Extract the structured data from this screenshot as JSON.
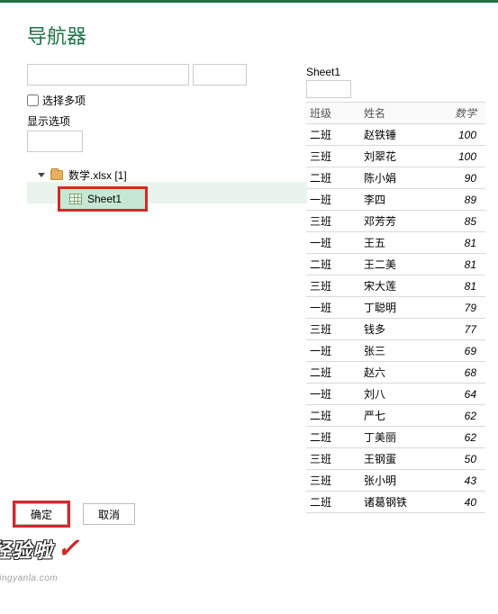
{
  "title": "导航器",
  "search": {
    "value": "",
    "placeholder": ""
  },
  "multi_select_label": "选择多项",
  "display_options_label": "显示选项",
  "tree": {
    "root_label": "数学.xlsx [1]",
    "sheet_label": "Sheet1"
  },
  "preview_title": "Sheet1",
  "chart_data": {
    "type": "table",
    "columns": [
      "班级",
      "姓名",
      "数学"
    ],
    "rows": [
      [
        "二班",
        "赵铁锤",
        100
      ],
      [
        "三班",
        "刘翠花",
        100
      ],
      [
        "二班",
        "陈小娟",
        90
      ],
      [
        "一班",
        "李四",
        89
      ],
      [
        "三班",
        "邓芳芳",
        85
      ],
      [
        "一班",
        "王五",
        81
      ],
      [
        "二班",
        "王二美",
        81
      ],
      [
        "三班",
        "宋大莲",
        81
      ],
      [
        "一班",
        "丁聪明",
        79
      ],
      [
        "三班",
        "钱多",
        77
      ],
      [
        "一班",
        "张三",
        69
      ],
      [
        "二班",
        "赵六",
        68
      ],
      [
        "一班",
        "刘八",
        64
      ],
      [
        "二班",
        "严七",
        62
      ],
      [
        "二班",
        "丁美丽",
        62
      ],
      [
        "三班",
        "王钢蛋",
        50
      ],
      [
        "三班",
        "张小明",
        43
      ],
      [
        "二班",
        "诸葛钢铁",
        40
      ]
    ]
  },
  "buttons": {
    "ok": "确定",
    "cancel": "取消"
  },
  "watermark": {
    "main": "经验啦",
    "sub": "头jingyanla.com"
  }
}
